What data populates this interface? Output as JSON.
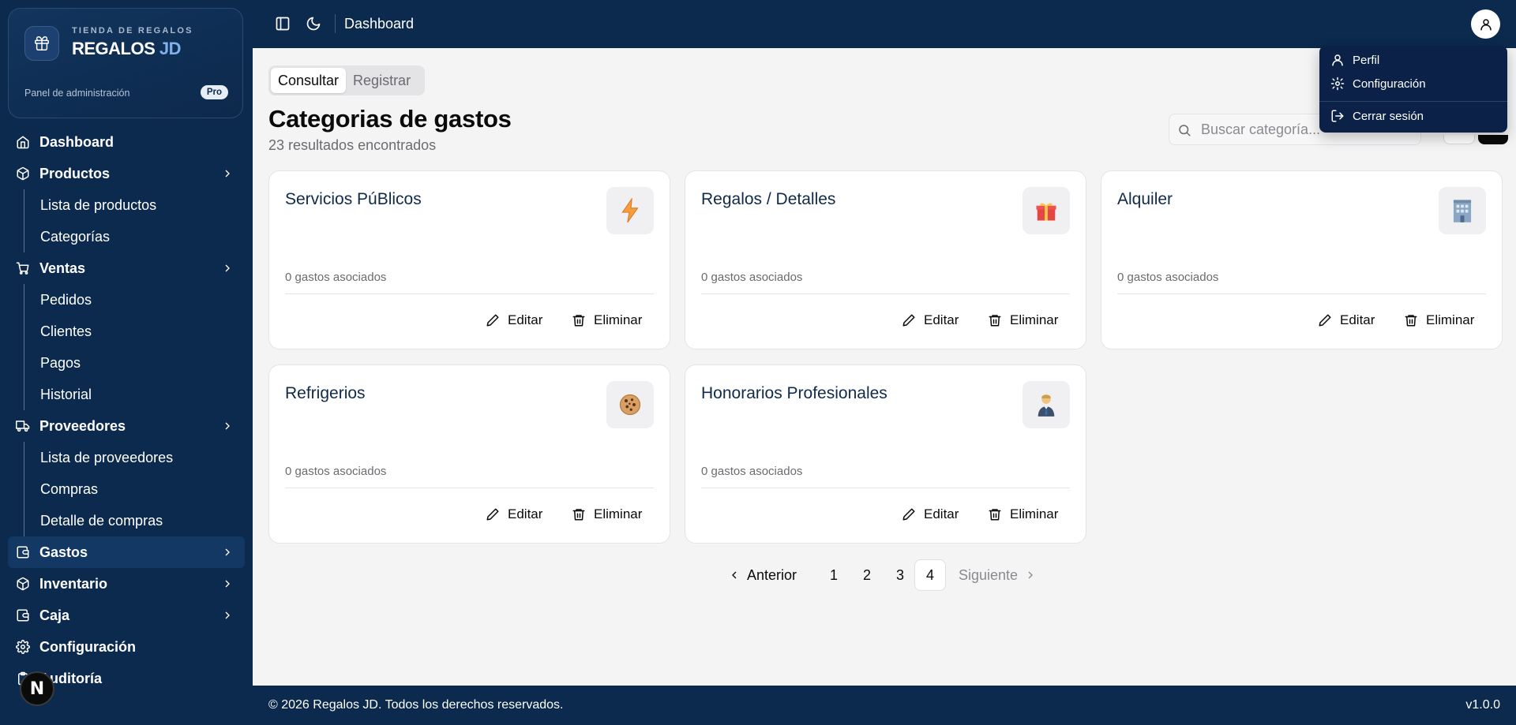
{
  "brand": {
    "subtitle": "TIENDA DE REGALOS",
    "name_main": "REGALOS",
    "name_accent": "JD",
    "panel": "Panel de administración",
    "badge": "Pro"
  },
  "sidebar": {
    "items": [
      {
        "label": "Dashboard",
        "icon": "home-icon"
      },
      {
        "label": "Productos",
        "icon": "box-icon",
        "children": [
          "Lista de productos",
          "Categorías"
        ]
      },
      {
        "label": "Ventas",
        "icon": "cart-icon",
        "children": [
          "Pedidos",
          "Clientes",
          "Pagos",
          "Historial"
        ]
      },
      {
        "label": "Proveedores",
        "icon": "truck-icon",
        "children": [
          "Lista de proveedores",
          "Compras",
          "Detalle de compras"
        ]
      },
      {
        "label": "Gastos",
        "icon": "wallet-icon"
      },
      {
        "label": "Inventario",
        "icon": "box-icon"
      },
      {
        "label": "Caja",
        "icon": "wallet-icon"
      },
      {
        "label": "Configuración",
        "icon": "gear-icon"
      },
      {
        "label": "Auditoría",
        "icon": "clipboard-icon"
      }
    ],
    "next_badge": "N"
  },
  "topbar": {
    "title": "Dashboard"
  },
  "user_menu": {
    "profile": "Perfil",
    "settings": "Configuración",
    "logout": "Cerrar sesión"
  },
  "main": {
    "tabs": [
      "Consultar",
      "Registrar"
    ],
    "title": "Categorias de gastos",
    "results": "23 resultados encontrados",
    "search_placeholder": "Buscar categoría..."
  },
  "cards": [
    {
      "title": "Servicios PúBlicos",
      "emoji": "⚡",
      "count": "0 gastos asociados"
    },
    {
      "title": "Regalos / Detalles",
      "emoji": "🎁",
      "count": "0 gastos asociados"
    },
    {
      "title": "Alquiler",
      "emoji": "🏢",
      "count": "0 gastos asociados"
    },
    {
      "title": "Refrigerios",
      "emoji": "🍪",
      "count": "0 gastos asociados"
    },
    {
      "title": "Honorarios Profesionales",
      "emoji": "👔",
      "count": "0 gastos asociados"
    }
  ],
  "card_actions": {
    "edit": "Editar",
    "delete": "Eliminar"
  },
  "pagination": {
    "prev": "Anterior",
    "pages": [
      "1",
      "2",
      "3",
      "4"
    ],
    "current": "4",
    "next": "Siguiente"
  },
  "footer": {
    "copyright": "© 2026 Regalos JD. Todos los derechos reservados.",
    "version": "v1.0.0"
  },
  "colors": {
    "navy": "#0c2a4d",
    "accent": "#7fb2ea",
    "background": "#f4f4f5"
  }
}
